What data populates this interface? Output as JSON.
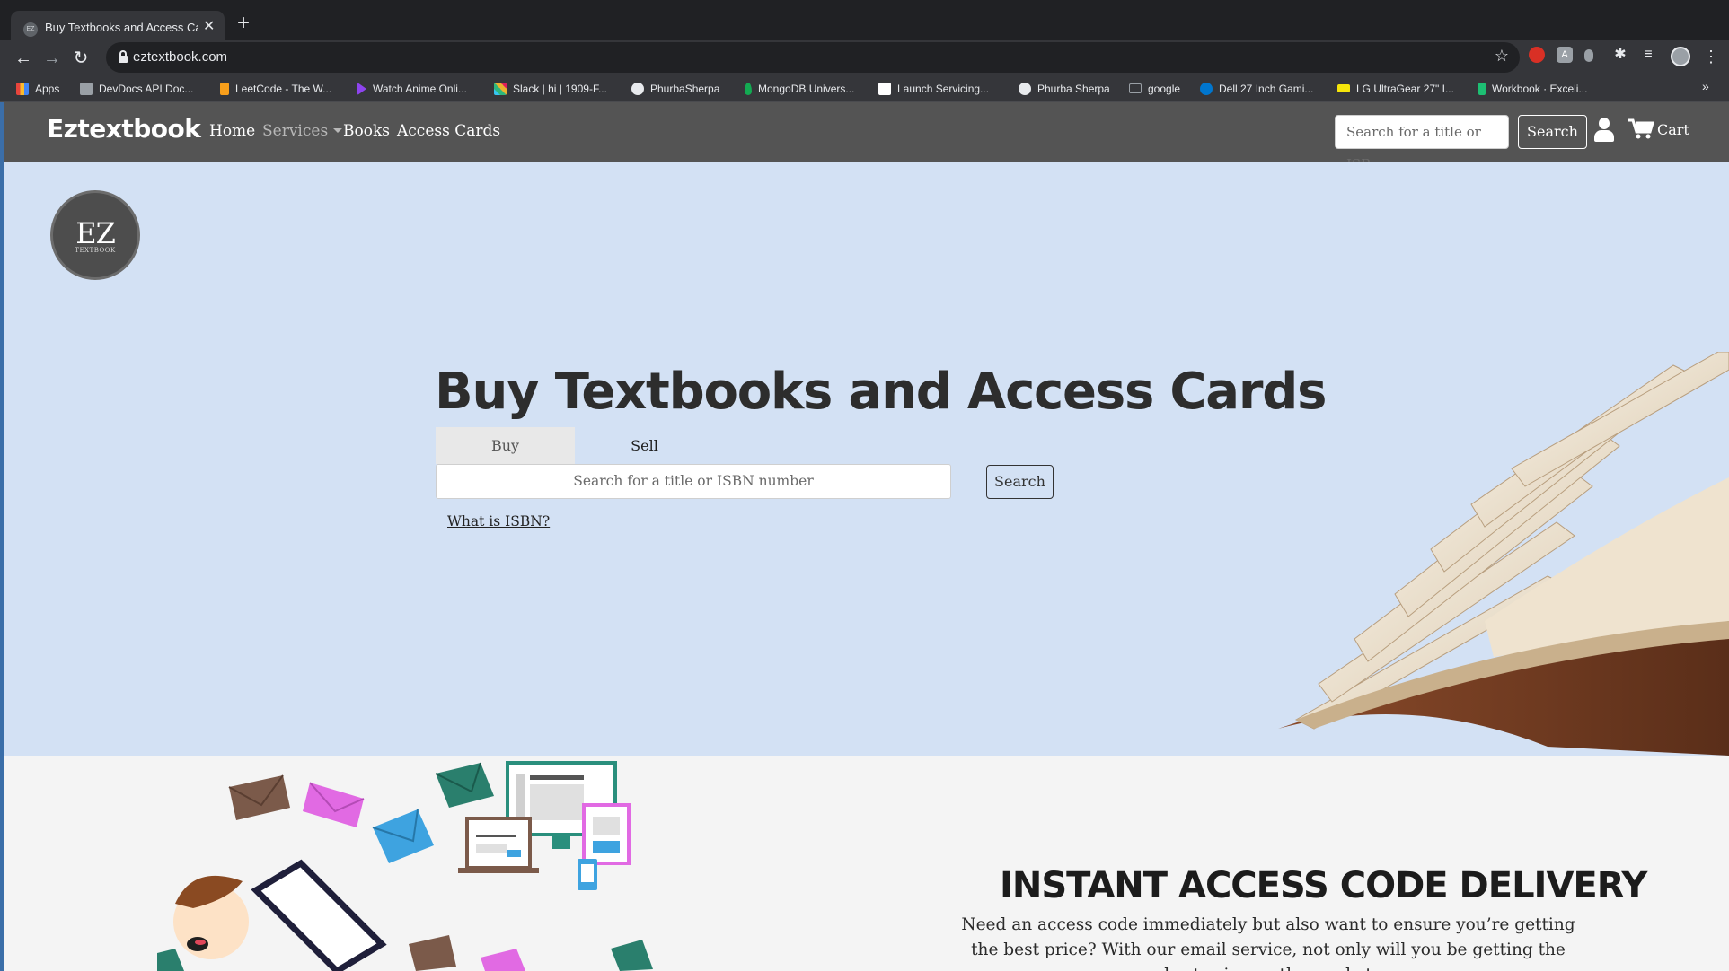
{
  "browser": {
    "tab_title": "Buy Textbooks and Access Cards",
    "tab_favicon_text": "EZ",
    "url": "eztextbook.com",
    "bookmarks": [
      {
        "label": "Apps",
        "color": "#e8453c"
      },
      {
        "label": "DevDocs API Doc...",
        "color": "#9aa0a6"
      },
      {
        "label": "LeetCode - The W...",
        "color": "#f89f1b"
      },
      {
        "label": "Watch Anime Onli...",
        "color": "#8e44ef"
      },
      {
        "label": "Slack | hi | 1909-F...",
        "color": "#e01e5a"
      },
      {
        "label": "PhurbaSherpa",
        "color": "#e8eaed"
      },
      {
        "label": "MongoDB Univers...",
        "color": "#13aa52"
      },
      {
        "label": "Launch Servicing...",
        "color": "#ffffff"
      },
      {
        "label": "Phurba Sherpa",
        "color": "#e8eaed"
      },
      {
        "label": "google",
        "color": "#9aa0a6"
      },
      {
        "label": "Dell 27 Inch Gami...",
        "color": "#0076ce"
      },
      {
        "label": "LG UltraGear 27\" I...",
        "color": "#f5e50a"
      },
      {
        "label": "Workbook · Exceli...",
        "color": "#1dbf73"
      }
    ]
  },
  "site": {
    "brand": "Eztextbook",
    "nav": {
      "home": "Home",
      "services": "Services",
      "books": "Books",
      "access_cards": "Access Cards"
    },
    "search_placeholder": "Search for a title or ISB",
    "search_button": "Search",
    "cart": "Cart"
  },
  "hero": {
    "logo_mark": "EZ",
    "logo_sub": "TEXTBOOK",
    "title": "Buy Textbooks and Access Cards",
    "tab_buy": "Buy",
    "tab_sell": "Sell",
    "search_placeholder": "Search for a title or ISBN number",
    "search_button": "Search",
    "isbn_link": "What is ISBN?"
  },
  "section2": {
    "title": "INSTANT ACCESS CODE DELIVERY",
    "body": "Need an access code immediately but also want to ensure you’re getting the best price? With our email service, not only will you be getting the best price on the market"
  },
  "colors": {
    "nav_bg": "#545454",
    "hero_bg": "#d3e1f4",
    "section2_bg": "#f4f4f4"
  }
}
